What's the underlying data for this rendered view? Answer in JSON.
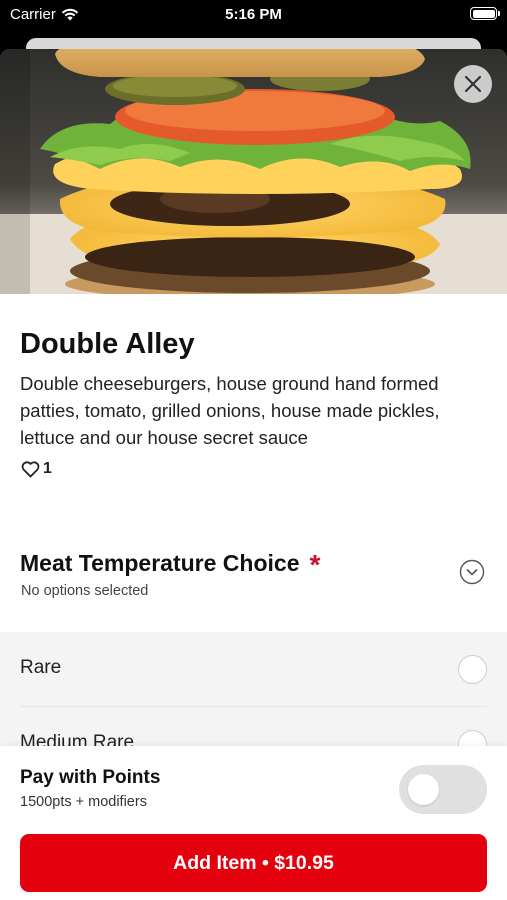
{
  "status_bar": {
    "carrier": "Carrier",
    "time": "5:16 PM",
    "icons": [
      "wifi-icon",
      "battery-icon"
    ]
  },
  "item": {
    "name": "Double Alley",
    "description": "Double cheeseburgers, house ground hand formed patties, tomato, grilled onions, house made pickles, lettuce and our house secret sauce",
    "likes": "1",
    "image": "double-cheeseburger-photo"
  },
  "modifier_group": {
    "title": "Meat Temperature Choice",
    "required_mark": "*",
    "subtitle": "No options selected",
    "options": [
      {
        "label": "Rare",
        "selected": false
      },
      {
        "label": "Medium Rare",
        "selected": false
      }
    ]
  },
  "footer": {
    "pay_title": "Pay with Points",
    "pay_subtitle": "1500pts + modifiers",
    "pay_with_points_enabled": false,
    "add_button_label": "Add Item • $10.95"
  },
  "colors": {
    "accent": "#E4000C",
    "required": "#C8102E",
    "toggle_off": "#E0E0E0"
  }
}
